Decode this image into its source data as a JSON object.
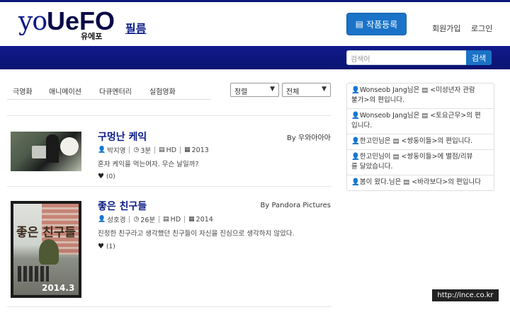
{
  "header": {
    "logo": {
      "main_left": "yo",
      "main_mid": "UeFO",
      "sub": "유에포"
    },
    "nav_film": "필름",
    "register_button": {
      "icon": "film-icon",
      "label": "작품등록"
    },
    "signup": "회원가입",
    "login": "로그인"
  },
  "search": {
    "placeholder": "검색어",
    "button": "검색"
  },
  "categories": [
    "극영화",
    "애니메이션",
    "다큐멘터리",
    "실험영화"
  ],
  "filters": {
    "sort": "정렬",
    "range": "전체"
  },
  "movies": [
    {
      "title": "구멍난 케익",
      "by": "By 우와아아아",
      "director": "박지영",
      "duration": "3분",
      "quality": "HD",
      "year": "2013",
      "description": "혼자 케익을 먹는여자. 무슨 날일까?",
      "likes": "(0)"
    },
    {
      "title": "좋은 친구들",
      "by": "By Pandora Pictures",
      "director": "성호경",
      "duration": "26분",
      "quality": "HD",
      "year": "2014",
      "description": "진정한 친구라고 생각했던 친구들이 자신을 진심으로 생각하지 않았다.",
      "likes": "(1)",
      "poster_title": "좋은 친구들",
      "poster_year": "2014.3"
    }
  ],
  "activity": [
    {
      "line1": "Wonseob Jang님은 ▤ <미성년자 관람",
      "line2": "불가>의 편입니다."
    },
    {
      "line1": "Wonseob Jang님은 ▤ <토요근무>의 편",
      "line2": "입니다."
    },
    {
      "line1": "한고민님은 ▤ <쌍둥이들>의 편입니다.",
      "line2": ""
    },
    {
      "line1": "한고민님이 ▤ <쌍둥이들>에 별점/리뷰",
      "line2": "를 달았습니다."
    },
    {
      "line1": "봄이 왔다.님은 ▤ <바라보다>의 편입니다",
      "line2": ""
    }
  ],
  "watermark": "http://ince.co.kr",
  "colors": {
    "brand": "#0b1b86",
    "navbar": "#0e1780",
    "button": "#1a73c8"
  }
}
